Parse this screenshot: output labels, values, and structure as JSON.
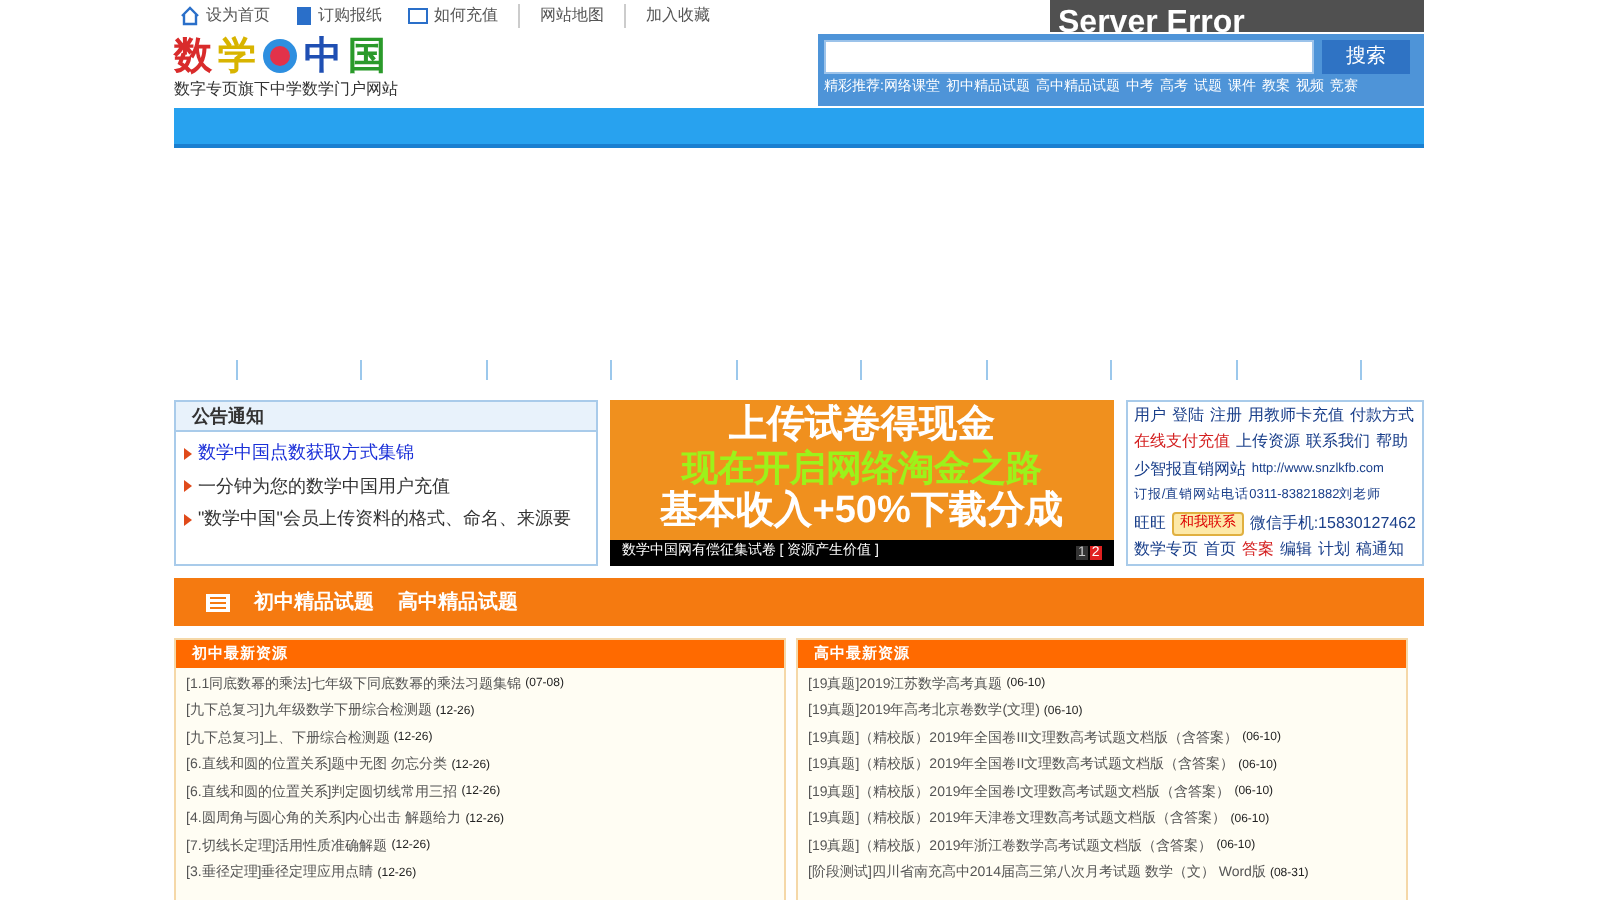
{
  "top_links": [
    {
      "label": "设为首页"
    },
    {
      "label": "订购报纸"
    },
    {
      "label": "如何充值"
    },
    {
      "label": "网站地图"
    },
    {
      "label": "加入收藏"
    }
  ],
  "error_box": {
    "title": "Server Error"
  },
  "logo": {
    "chars": [
      "数",
      "学",
      "中",
      "国"
    ],
    "tagline": "数字专页旗下中学数学门户网站"
  },
  "search": {
    "button": "搜索",
    "links": [
      "精彩推荐:网络课堂",
      "初中精品试题",
      "高中精品试题",
      "中考",
      "高考",
      "试题",
      "课件",
      "教案",
      "视频",
      "竞赛"
    ]
  },
  "notice": {
    "title": "公告通知",
    "items": [
      {
        "text": "数学中国点数获取方式集锦",
        "highlight": true
      },
      {
        "text": "一分钟为您的数学中国用户充值",
        "highlight": false
      },
      {
        "text": "\"数学中国\"会员上传资料的格式、命名、来源要",
        "highlight": false
      }
    ]
  },
  "banner": {
    "lines": [
      "上传试卷得现金",
      "现在开启网络淘金之路",
      "基本收入+50%下载分成"
    ],
    "caption": "数学中国网有偿征集试卷 [ 资源产生价值 ]",
    "pages": [
      {
        "label": "1",
        "selected": false
      },
      {
        "label": "2",
        "selected": true
      }
    ]
  },
  "links_box": {
    "lines": [
      {
        "items": [
          {
            "kind": "link",
            "text": "用户",
            "hot": false
          },
          {
            "kind": "link",
            "text": "登陆",
            "hot": false
          },
          {
            "kind": "link",
            "text": "注册",
            "hot": false
          },
          {
            "kind": "link",
            "text": "用教师卡充值",
            "hot": false
          },
          {
            "kind": "link",
            "text": "付款方式",
            "hot": false
          }
        ]
      },
      {
        "items": [
          {
            "kind": "link",
            "text": "在线支付充值",
            "hot": true
          },
          {
            "kind": "link",
            "text": "上传资源",
            "hot": false
          },
          {
            "kind": "link",
            "text": "联系我们",
            "hot": false
          },
          {
            "kind": "link",
            "text": "帮助",
            "hot": false
          }
        ]
      },
      {
        "items": [
          {
            "kind": "link",
            "text": "少智报直销网站",
            "hot": false
          },
          {
            "kind": "link",
            "text": "http://www.snzlkfb.com",
            "hot": false
          }
        ]
      },
      {
        "items": [
          {
            "kind": "link",
            "text": "订报/直销网站电话0311-83821882刘老师",
            "hot": false
          }
        ]
      },
      {
        "items": [
          {
            "kind": "link",
            "text": "旺旺",
            "hot": false
          },
          {
            "kind": "button",
            "text": "和我联系"
          },
          {
            "kind": "link",
            "text": "微信手机:15830127462",
            "hot": false
          }
        ]
      },
      {
        "items": [
          {
            "kind": "link",
            "text": "数学专页",
            "hot": false
          },
          {
            "kind": "link",
            "text": "首页",
            "hot": false
          },
          {
            "kind": "link",
            "text": "答案",
            "hot": true
          },
          {
            "kind": "link",
            "text": "编辑",
            "hot": false
          },
          {
            "kind": "link",
            "text": "计划",
            "hot": false
          },
          {
            "kind": "link",
            "text": "稿通知",
            "hot": false
          }
        ]
      }
    ]
  },
  "section_tabs": [
    "初中精品试题",
    "高中精品试题"
  ],
  "columns": [
    {
      "title": "初中最新资源",
      "items": [
        {
          "text": "[1.1同底数幂的乘法]七年级下同底数幂的乘法习题集锦",
          "date": "(07-08)"
        },
        {
          "text": "[九下总复习]九年级数学下册综合检测题",
          "date": "(12-26)"
        },
        {
          "text": "[九下总复习]上、下册综合检测题",
          "date": "(12-26)"
        },
        {
          "text": "[6.直线和圆的位置关系]题中无图  勿忘分类",
          "date": "(12-26)"
        },
        {
          "text": "[6.直线和圆的位置关系]判定圆切线常用三招",
          "date": "(12-26)"
        },
        {
          "text": "[4.圆周角与圆心角的关系]内心出击  解题给力",
          "date": "(12-26)"
        },
        {
          "text": "[7.切线长定理]活用性质准确解题",
          "date": "(12-26)"
        },
        {
          "text": "[3.垂径定理]垂径定理应用点睛",
          "date": "(12-26)"
        }
      ]
    },
    {
      "title": "高中最新资源",
      "items": [
        {
          "text": "[19真题]2019江苏数学高考真题",
          "date": "(06-10)"
        },
        {
          "text": "[19真题]2019年高考北京卷数学(文理)",
          "date": "(06-10)"
        },
        {
          "text": "[19真题]（精校版）2019年全国卷III文理数高考试题文档版（含答案）",
          "date": "(06-10)"
        },
        {
          "text": "[19真题]（精校版）2019年全国卷II文理数高考试题文档版（含答案）",
          "date": "(06-10)"
        },
        {
          "text": "[19真题]（精校版）2019年全国卷I文理数高考试题文档版（含答案）",
          "date": "(06-10)"
        },
        {
          "text": "[19真题]（精校版）2019年天津卷文理数高考试题文档版（含答案）",
          "date": "(06-10)"
        },
        {
          "text": "[19真题]（精校版）2019年浙江卷数学高考试题文档版（含答案）",
          "date": "(06-10)"
        },
        {
          "text": "[阶段测试]四川省南充高中2014届高三第八次月考试题 数学（文） Word版",
          "date": "(08-31)"
        }
      ]
    }
  ]
}
